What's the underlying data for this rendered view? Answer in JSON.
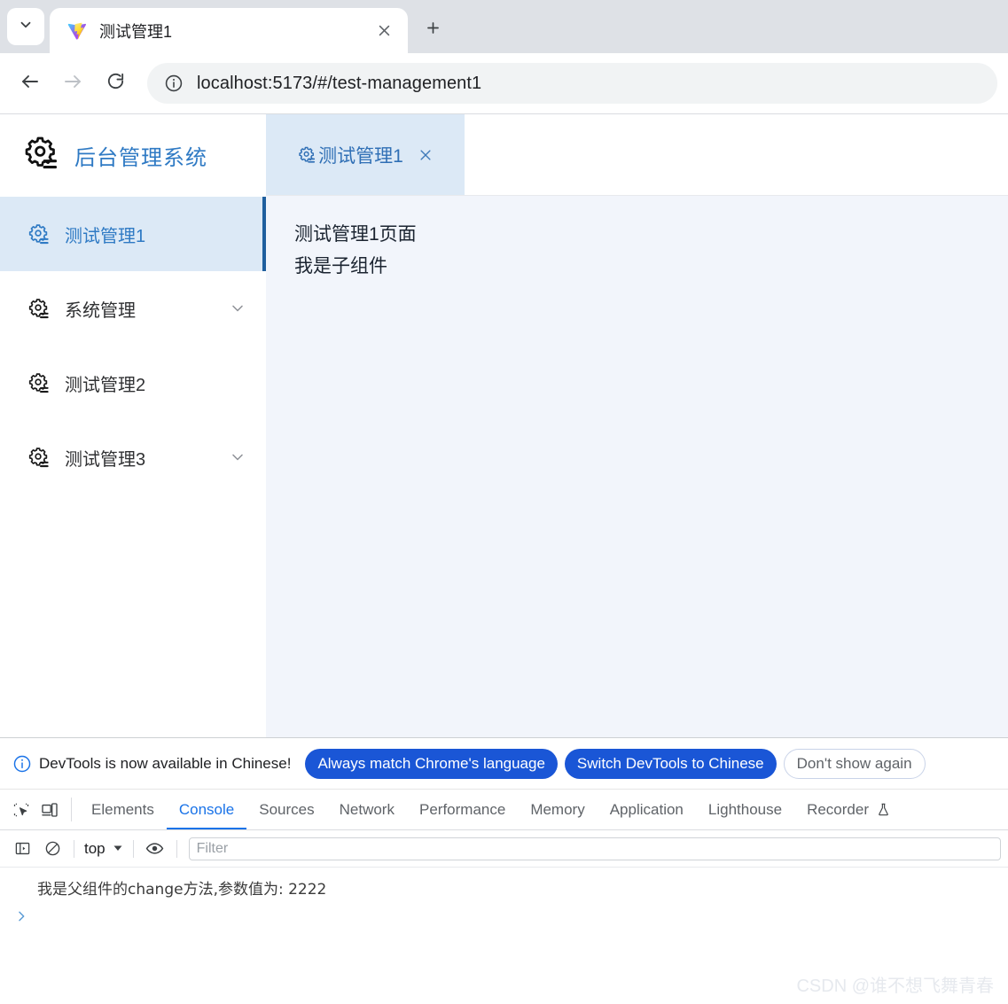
{
  "browser": {
    "tab_list_icon": "chevron-down-icon",
    "tab": {
      "favicon": "vite-logo-icon",
      "title": "测试管理1",
      "close_icon": "close-icon"
    },
    "new_tab_icon": "plus-icon",
    "nav": {
      "back_icon": "arrow-left-icon",
      "forward_icon": "arrow-right-icon",
      "reload_icon": "reload-icon"
    },
    "omnibox": {
      "site_info_icon": "info-circle-icon",
      "url": "localhost:5173/#/test-management1"
    }
  },
  "app": {
    "brand": {
      "logo_icon": "gear-settings-icon",
      "title": "后台管理系统",
      "color": "#2f7ac4"
    },
    "sidebar": {
      "items": [
        {
          "icon": "gear-settings-icon",
          "label": "测试管理1",
          "active": true,
          "has_arrow": false
        },
        {
          "icon": "gear-settings-icon",
          "label": "系统管理",
          "active": false,
          "has_arrow": true
        },
        {
          "icon": "gear-settings-icon",
          "label": "测试管理2",
          "active": false,
          "has_arrow": false
        },
        {
          "icon": "gear-settings-icon",
          "label": "测试管理3",
          "active": false,
          "has_arrow": true
        }
      ]
    },
    "tabs": [
      {
        "icon": "gear-settings-icon",
        "label": "测试管理1",
        "close_icon": "close-icon",
        "active": true
      }
    ],
    "content": {
      "lines": [
        "测试管理1页面",
        "我是子组件"
      ]
    }
  },
  "devtools": {
    "notice": {
      "icon": "info-circle-icon",
      "text": "DevTools is now available in Chinese!",
      "buttons": [
        {
          "label": "Always match Chrome's language",
          "style": "primary"
        },
        {
          "label": "Switch DevTools to Chinese",
          "style": "primary"
        },
        {
          "label": "Don't show again",
          "style": "ghost"
        }
      ],
      "primary_color": "#1a56d6"
    },
    "tools": {
      "inspect_icon": "inspect-element-icon",
      "device_icon": "device-toolbar-icon"
    },
    "tabs": [
      {
        "label": "Elements",
        "active": false
      },
      {
        "label": "Console",
        "active": true
      },
      {
        "label": "Sources",
        "active": false
      },
      {
        "label": "Network",
        "active": false
      },
      {
        "label": "Performance",
        "active": false
      },
      {
        "label": "Memory",
        "active": false
      },
      {
        "label": "Application",
        "active": false
      },
      {
        "label": "Lighthouse",
        "active": false
      },
      {
        "label": "Recorder",
        "active": false,
        "trailing_icon": "flask-icon"
      }
    ],
    "filterbar": {
      "sidebar_icon": "console-sidebar-icon",
      "clear_icon": "clear-console-icon",
      "context": "top",
      "context_arrow_icon": "triangle-down-icon",
      "eye_icon": "live-expression-eye-icon",
      "filter_placeholder": "Filter"
    },
    "console": {
      "messages": [
        "我是父组件的change方法,参数值为: 2222"
      ],
      "prompt_icon": "chevron-right-icon"
    }
  },
  "watermark": {
    "text": "CSDN @谁不想飞舞青春"
  }
}
